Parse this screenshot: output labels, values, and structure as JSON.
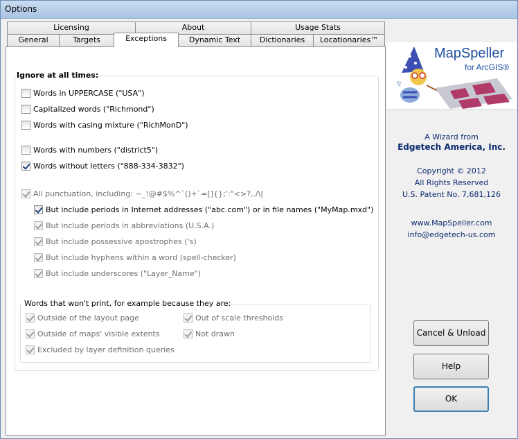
{
  "window": {
    "title": "Options"
  },
  "tabs_row1": [
    "Licensing",
    "About",
    "Usage Stats"
  ],
  "tabs_row2": [
    "General",
    "Targets",
    "Exceptions",
    "Dynamic Text",
    "Dictionaries",
    "Locationaries™"
  ],
  "ignore_group": {
    "title": "Ignore at all times:",
    "items": [
      {
        "label": "Words in UPPERCASE (\"USA\")",
        "checked": false,
        "enabled": true
      },
      {
        "label": "Capitalized words (\"Richmond\")",
        "checked": false,
        "enabled": true
      },
      {
        "label": "Words with casing mixture (\"RichMonD\")",
        "checked": false,
        "enabled": true
      },
      {
        "label": "Words with numbers (\"district5\")",
        "checked": false,
        "enabled": true
      },
      {
        "label": "Words without letters (\"888-334-3832\")",
        "checked": true,
        "enabled": true
      },
      {
        "label": "All punctuation, including: ~_!@#$%^`()+`=[]{};':\"<>?,./\\|",
        "checked": true,
        "enabled": false
      },
      {
        "label": "But include periods in Internet addresses (\"abc.com\") or in file names (\"MyMap.mxd\")",
        "checked": true,
        "enabled": true
      },
      {
        "label": "But include periods in abbreviations (U.S.A.)",
        "checked": true,
        "enabled": false
      },
      {
        "label": "But include possessive apostrophes ('s)",
        "checked": true,
        "enabled": false
      },
      {
        "label": "But include hyphens within a word (spell-checker)",
        "checked": true,
        "enabled": false
      },
      {
        "label": "But include underscores (\"Layer_Name\")",
        "checked": true,
        "enabled": false
      }
    ]
  },
  "print_group": {
    "title": "Words that won't print, for example because they are:",
    "items": [
      {
        "label": "Outside of the layout page",
        "checked": true
      },
      {
        "label": "Outside of maps' visible extents",
        "checked": true
      },
      {
        "label": "Excluded by layer definition queries",
        "checked": true
      },
      {
        "label": "Out of scale thresholds",
        "checked": true
      },
      {
        "label": "Not drawn",
        "checked": true
      }
    ]
  },
  "side": {
    "logo_title": "MapSpeller",
    "logo_sub": "for ArcGIS®",
    "wizard_from": "A Wizard from",
    "company": "Edgetech America, Inc.",
    "copyright": "Copyright © 2012",
    "rights": "All Rights Reserved",
    "patent": "U.S. Patent No. 7,681,126",
    "website": "www.MapSpeller.com",
    "email": "info@edgetech-us.com"
  },
  "buttons": {
    "cancel": "Cancel & Unload",
    "help": "Help",
    "ok": "OK"
  }
}
